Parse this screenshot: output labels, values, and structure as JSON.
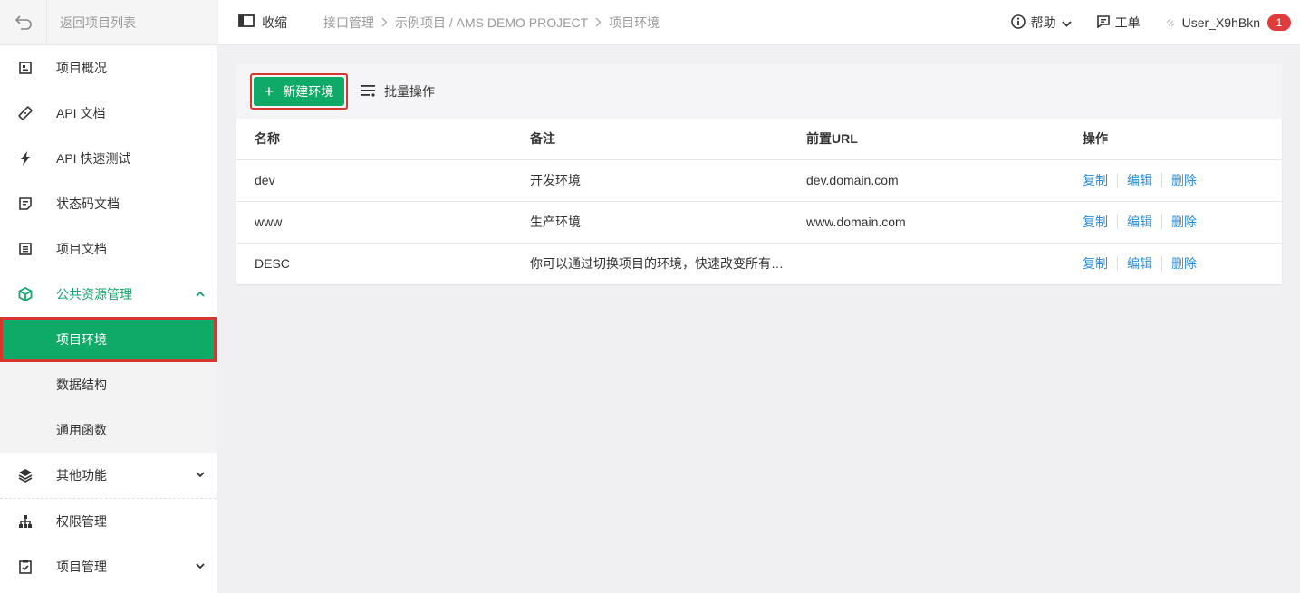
{
  "sidebar": {
    "back_label": "返回项目列表",
    "items": [
      {
        "label": "项目概况",
        "icon": "overview-icon"
      },
      {
        "label": "API 文档",
        "icon": "api-doc-icon"
      },
      {
        "label": "API 快速测试",
        "icon": "lightning-icon"
      },
      {
        "label": "状态码文档",
        "icon": "status-doc-icon"
      },
      {
        "label": "项目文档",
        "icon": "project-doc-icon"
      }
    ],
    "group": {
      "label": "公共资源管理",
      "icon": "cube-icon",
      "expanded": true
    },
    "sub_items": [
      {
        "label": "项目环境",
        "active": true
      },
      {
        "label": "数据结构",
        "active": false
      },
      {
        "label": "通用函数",
        "active": false
      }
    ],
    "other": {
      "label": "其他功能",
      "icon": "layers-icon"
    },
    "permission": {
      "label": "权限管理",
      "icon": "org-chart-icon"
    },
    "project_manage": {
      "label": "项目管理",
      "icon": "clipboard-icon"
    }
  },
  "topbar": {
    "collapse_label": "收缩",
    "breadcrumb": [
      "接口管理",
      "示例项目 / AMS DEMO PROJECT",
      "项目环境"
    ],
    "help_label": "帮助",
    "ticket_label": "工单",
    "user_label": "User_X9hBkn",
    "notification_count": "1"
  },
  "toolbar": {
    "new_label": "新建环境",
    "bulk_label": "批量操作"
  },
  "table": {
    "headers": [
      "名称",
      "备注",
      "前置URL",
      "操作"
    ],
    "rows": [
      {
        "name": "dev",
        "note": "开发环境",
        "url": "dev.domain.com"
      },
      {
        "name": "www",
        "note": "生产环境",
        "url": "www.domain.com"
      },
      {
        "name": "DESC",
        "note": "你可以通过切换项目的环境，快速改变所有API的前置URL",
        "url": ""
      }
    ],
    "actions": {
      "copy": "复制",
      "edit": "编辑",
      "delete": "删除"
    }
  },
  "colors": {
    "accent": "#0fa968",
    "link": "#2d8fd9",
    "highlight": "#d9362b",
    "badge": "#e03c3c"
  }
}
